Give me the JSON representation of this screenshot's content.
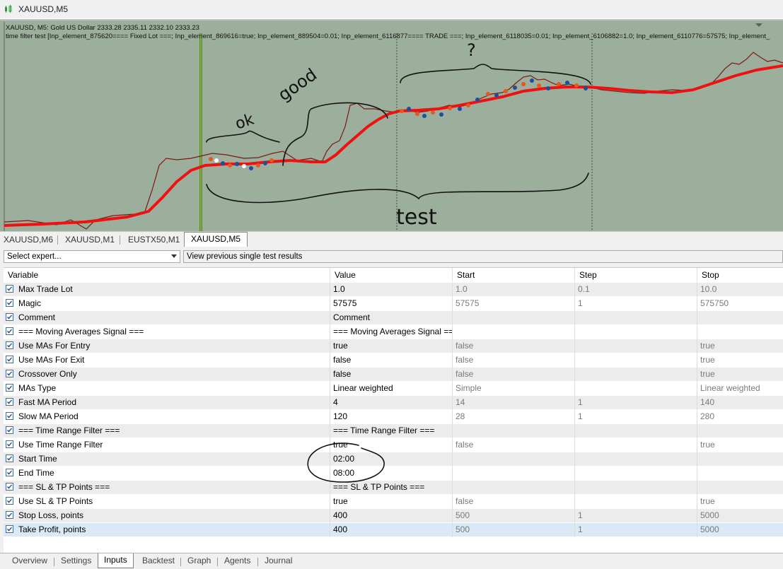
{
  "window": {
    "title": "XAUUSD,M5",
    "icon": "candlestick-chart-icon"
  },
  "chart": {
    "info_line1": "XAUUSD, M5:  Gold US Dollar  2333.28 2335.11 2332.10 2333.23",
    "info_line2": "time filter test [Inp_element_875620==== Fixed Lot ===; Inp_element_869616=true; Inp_element_889504=0.01; Inp_element_6116877==== TRADE ===; Inp_element_6118035=0.01; Inp_element_6106882=1.0; Inp_element_6110776=57575; Inp_element_",
    "annotations": {
      "ok": "ok",
      "good": "good",
      "question": "?",
      "test": "test"
    },
    "colors": {
      "background": "#9cae9c",
      "ma": "#ee1111",
      "price": "#7a1a14",
      "buy": "#1f4e9c",
      "sell": "#e8551d"
    }
  },
  "chart_tabs": [
    {
      "label": "XAUUSD,M6",
      "active": false
    },
    {
      "label": "XAUUSD,M1",
      "active": false
    },
    {
      "label": "EUSTX50,M1",
      "active": false
    },
    {
      "label": "XAUUSD,M5",
      "active": true
    }
  ],
  "toolbar": {
    "expert_select": "Select expert...",
    "view_previous": "View previous single test results"
  },
  "inputs": {
    "columns": [
      "Variable",
      "Value",
      "Start",
      "Step",
      "Stop"
    ],
    "rows": [
      {
        "name": "Max Trade Lot",
        "value": "1.0",
        "start": "1.0",
        "step": "0.1",
        "stop": "10.0"
      },
      {
        "name": "Magic",
        "value": "57575",
        "start": "57575",
        "step": "1",
        "stop": "575750"
      },
      {
        "name": "Comment",
        "value": "Comment",
        "start": "",
        "step": "",
        "stop": ""
      },
      {
        "name": "=== Moving Averages Signal ===",
        "value": "=== Moving Averages Signal ===",
        "start": "",
        "step": "",
        "stop": ""
      },
      {
        "name": "Use MAs For Entry",
        "value": "true",
        "start": "false",
        "step": "",
        "stop": "true"
      },
      {
        "name": "Use MAs For Exit",
        "value": "false",
        "start": "false",
        "step": "",
        "stop": "true"
      },
      {
        "name": "Crossover Only",
        "value": "false",
        "start": "false",
        "step": "",
        "stop": "true"
      },
      {
        "name": "MAs Type",
        "value": "Linear weighted",
        "start": "Simple",
        "step": "",
        "stop": "Linear weighted"
      },
      {
        "name": "Fast MA Period",
        "value": "4",
        "start": "14",
        "step": "1",
        "stop": "140"
      },
      {
        "name": "Slow MA Period",
        "value": "120",
        "start": "28",
        "step": "1",
        "stop": "280"
      },
      {
        "name": "=== Time Range Filter ===",
        "value": "=== Time Range Filter ===",
        "start": "",
        "step": "",
        "stop": ""
      },
      {
        "name": "Use Time Range Filter",
        "value": "true",
        "start": "false",
        "step": "",
        "stop": "true"
      },
      {
        "name": "Start Time",
        "value": "02:00",
        "start": "",
        "step": "",
        "stop": ""
      },
      {
        "name": "End Time",
        "value": "08:00",
        "start": "",
        "step": "",
        "stop": ""
      },
      {
        "name": "=== SL & TP Points ===",
        "value": "=== SL & TP Points ===",
        "start": "",
        "step": "",
        "stop": ""
      },
      {
        "name": "Use SL & TP Points",
        "value": "true",
        "start": "false",
        "step": "",
        "stop": "true"
      },
      {
        "name": "Stop Loss, points",
        "value": "400",
        "start": "500",
        "step": "1",
        "stop": "5000"
      },
      {
        "name": "Take Profit, points",
        "value": "400",
        "start": "500",
        "step": "1",
        "stop": "5000"
      }
    ]
  },
  "bottom_tabs": [
    {
      "label": "Overview",
      "active": false
    },
    {
      "label": "Settings",
      "active": false
    },
    {
      "label": "Inputs",
      "active": true
    },
    {
      "label": "Backtest",
      "active": false
    },
    {
      "label": "Graph",
      "active": false
    },
    {
      "label": "Agents",
      "active": false
    },
    {
      "label": "Journal",
      "active": false
    }
  ]
}
